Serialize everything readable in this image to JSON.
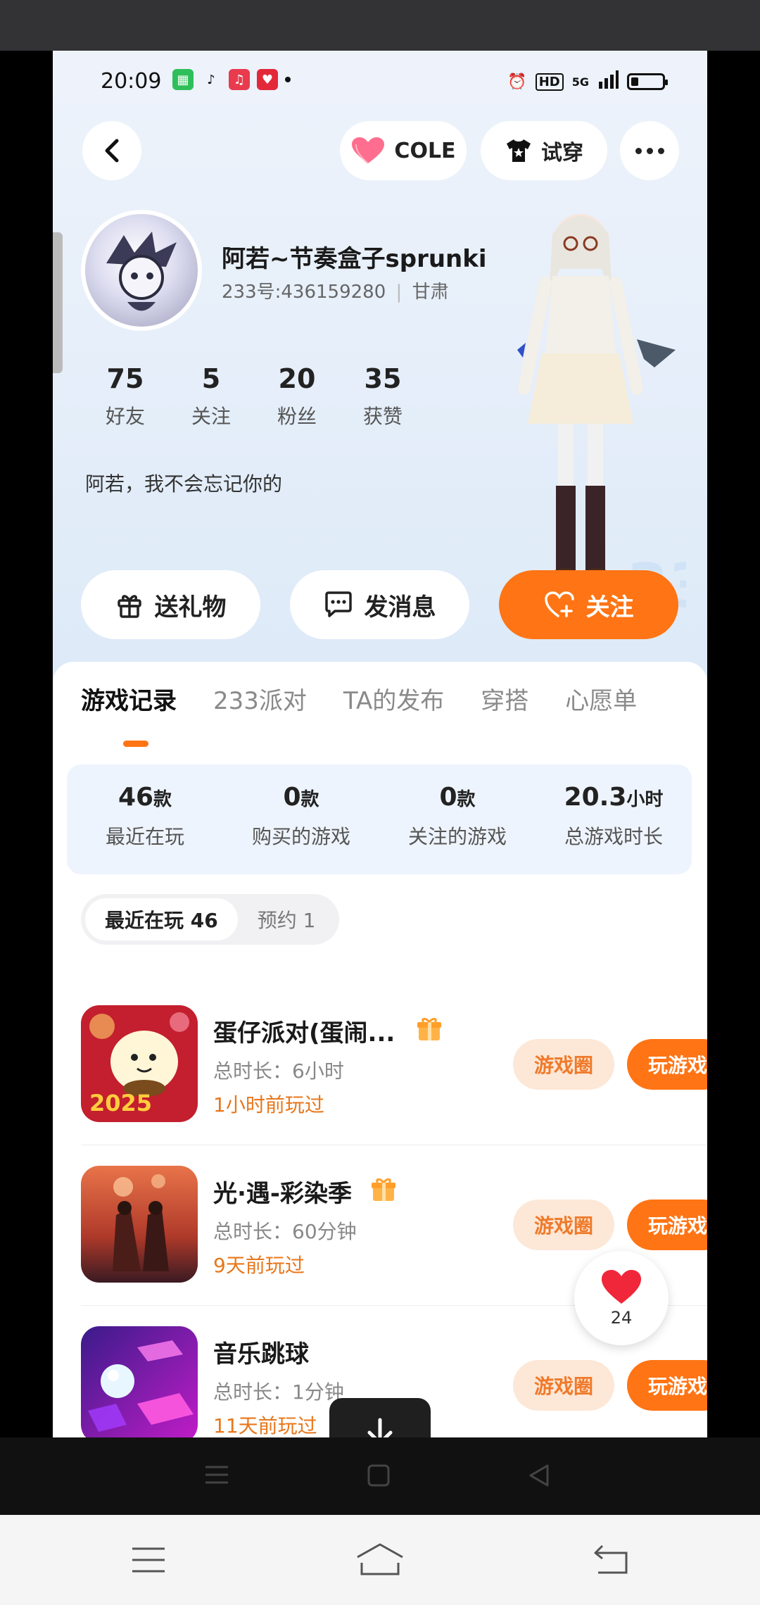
{
  "status_bar": {
    "time": "20:09",
    "network": "5G",
    "hd": "HD"
  },
  "header": {
    "cole_label": "COLE",
    "try_label": "试穿"
  },
  "profile": {
    "nickname": "阿若~节奏盒子sprunki",
    "uid_text": "233号:436159280",
    "region": "甘肃",
    "bio": "阿若，我不会忘记你的",
    "stats": [
      {
        "num": "75",
        "label": "好友"
      },
      {
        "num": "5",
        "label": "关注"
      },
      {
        "num": "20",
        "label": "粉丝"
      },
      {
        "num": "35",
        "label": "获赞"
      }
    ]
  },
  "actions": {
    "gift": "送礼物",
    "message": "发消息",
    "follow": "关注"
  },
  "tabs": [
    "游戏记录",
    "233派对",
    "TA的发布",
    "穿搭",
    "心愿单"
  ],
  "summary": [
    {
      "value": "46",
      "unit": "款",
      "label": "最近在玩"
    },
    {
      "value": "0",
      "unit": "款",
      "label": "购买的游戏"
    },
    {
      "value": "0",
      "unit": "款",
      "label": "关注的游戏"
    },
    {
      "value": "20.3",
      "unit": "小时",
      "label": "总游戏时长"
    }
  ],
  "segments": {
    "recent": "最近在玩 46",
    "reserve": "预约 1"
  },
  "games": [
    {
      "name": "蛋仔派对(蛋闹...",
      "duration": "总时长：6小时",
      "last_played": "1小时前玩过",
      "circle_label": "游戏圈",
      "play_label": "玩游戏"
    },
    {
      "name": "光·遇-彩染季",
      "duration": "总时长：60分钟",
      "last_played": "9天前玩过",
      "circle_label": "游戏圈",
      "play_label": "玩游戏"
    },
    {
      "name": "音乐跳球",
      "duration": "总时长：1分钟",
      "last_played": "11天前玩过",
      "circle_label": "游戏圈",
      "play_label": "玩游戏"
    }
  ],
  "like_count": "24",
  "colors": {
    "accent": "#ff7414",
    "accent_light": "#fde7d6",
    "played_text": "#e8771c"
  }
}
